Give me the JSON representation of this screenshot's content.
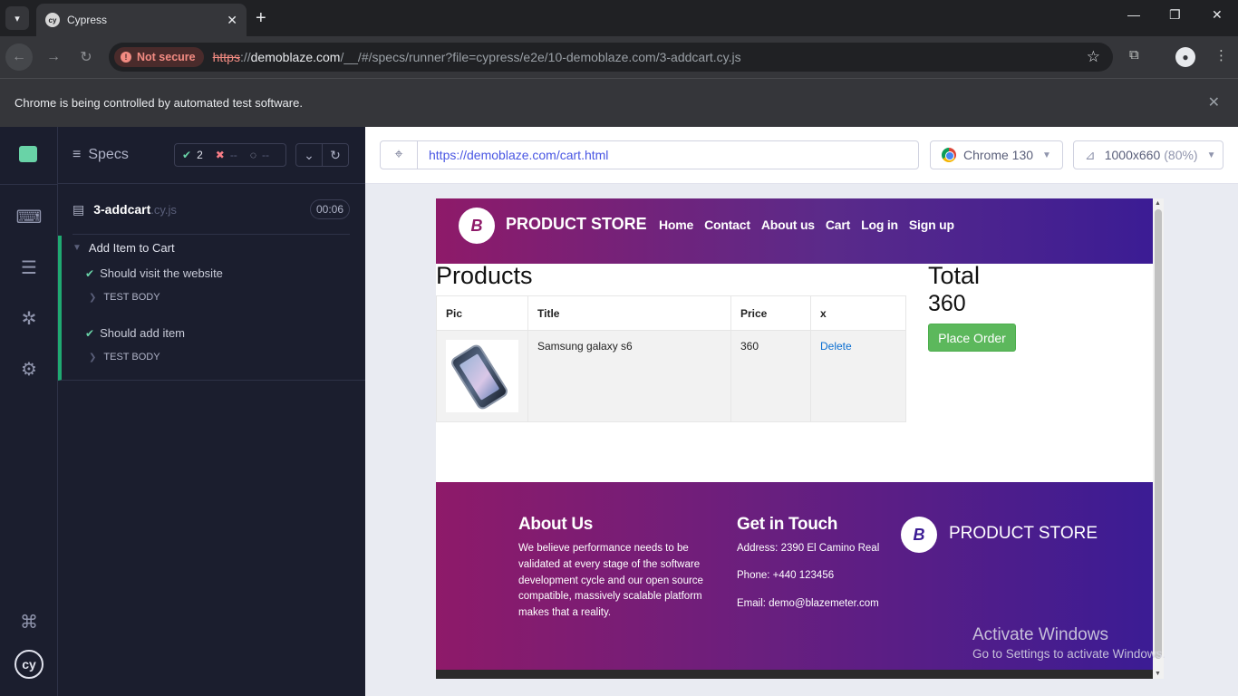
{
  "browser": {
    "tab_title": "Cypress",
    "tab_favicon": "cy",
    "security_label": "Not secure",
    "url_scheme": "https",
    "url_host": "demoblaze.com",
    "url_path": "/__/#/specs/runner?file=cypress/e2e/10-demoblaze.com/3-addcart.cy.js",
    "automation_banner": "Chrome is being controlled by automated test software."
  },
  "reporter": {
    "specs_label": "Specs",
    "passed_count": "2",
    "failed_count": "--",
    "pending_count": "--",
    "spec_name": "3-addcart",
    "spec_ext": ".cy.js",
    "duration": "00:06",
    "suite_title": "Add Item to Cart",
    "tests": [
      {
        "title": "Should visit the website",
        "body_label": "TEST BODY"
      },
      {
        "title": "Should add item",
        "body_label": "TEST BODY"
      }
    ]
  },
  "aut": {
    "url": "https://demoblaze.com/cart.html",
    "browser_name": "Chrome 130",
    "viewport": "1000x660",
    "viewport_scale": "(80%)"
  },
  "site": {
    "brand": "PRODUCT STORE",
    "brand_logo_letter": "B",
    "nav": [
      "Home",
      "Contact",
      "About us",
      "Cart",
      "Log in",
      "Sign up"
    ],
    "products_heading": "Products",
    "table_headers": [
      "Pic",
      "Title",
      "Price",
      "x"
    ],
    "cart_items": [
      {
        "title": "Samsung galaxy s6",
        "price": "360",
        "action": "Delete"
      }
    ],
    "total_heading": "Total",
    "total_value": "360",
    "place_order": "Place Order",
    "footer": {
      "about_heading": "About Us",
      "about_text": "We believe performance needs to be validated at every stage of the software development cycle and our open source compatible, massively scalable platform makes that a reality.",
      "contact_heading": "Get in Touch",
      "address": "Address: 2390 El Camino Real",
      "phone": "Phone: +440 123456",
      "email": "Email: demo@blazemeter.com",
      "brand": "PRODUCT STORE"
    }
  },
  "watermark": {
    "line1": "Activate Windows",
    "line2": "Go to Settings to activate Windows."
  },
  "colors": {
    "passed": "#69d3a7",
    "failed": "#f87d86",
    "brand_gradient_start": "#8e1a69",
    "brand_gradient_end": "#3b1c94",
    "place_order": "#5cb85c"
  }
}
